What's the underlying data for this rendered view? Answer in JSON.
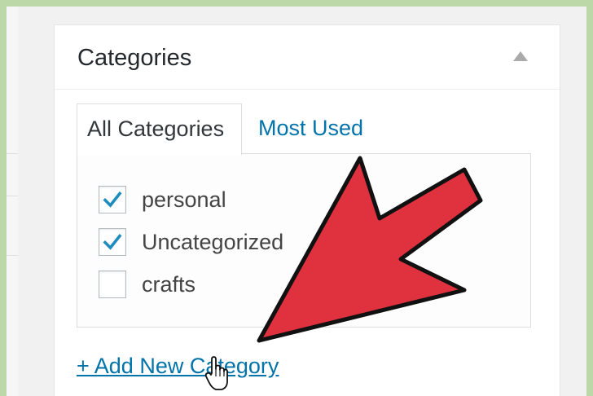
{
  "panel": {
    "title": "Categories"
  },
  "tabs": [
    {
      "label": "All Categories",
      "active": true
    },
    {
      "label": "Most Used",
      "active": false
    }
  ],
  "categories": [
    {
      "label": "personal",
      "checked": true
    },
    {
      "label": "Uncategorized",
      "checked": true
    },
    {
      "label": "crafts",
      "checked": false
    }
  ],
  "add_new": {
    "label": "+ Add New Category"
  },
  "colors": {
    "frame_green": "#bcd7a8",
    "link_blue": "#0073aa",
    "check_blue": "#1e8cbe",
    "arrow_red": "#e0313f"
  },
  "icons": {
    "collapse": "triangle-up-icon",
    "check": "checkmark-icon",
    "pointer": "hand-pointer-icon",
    "annotation": "red-arrow"
  }
}
